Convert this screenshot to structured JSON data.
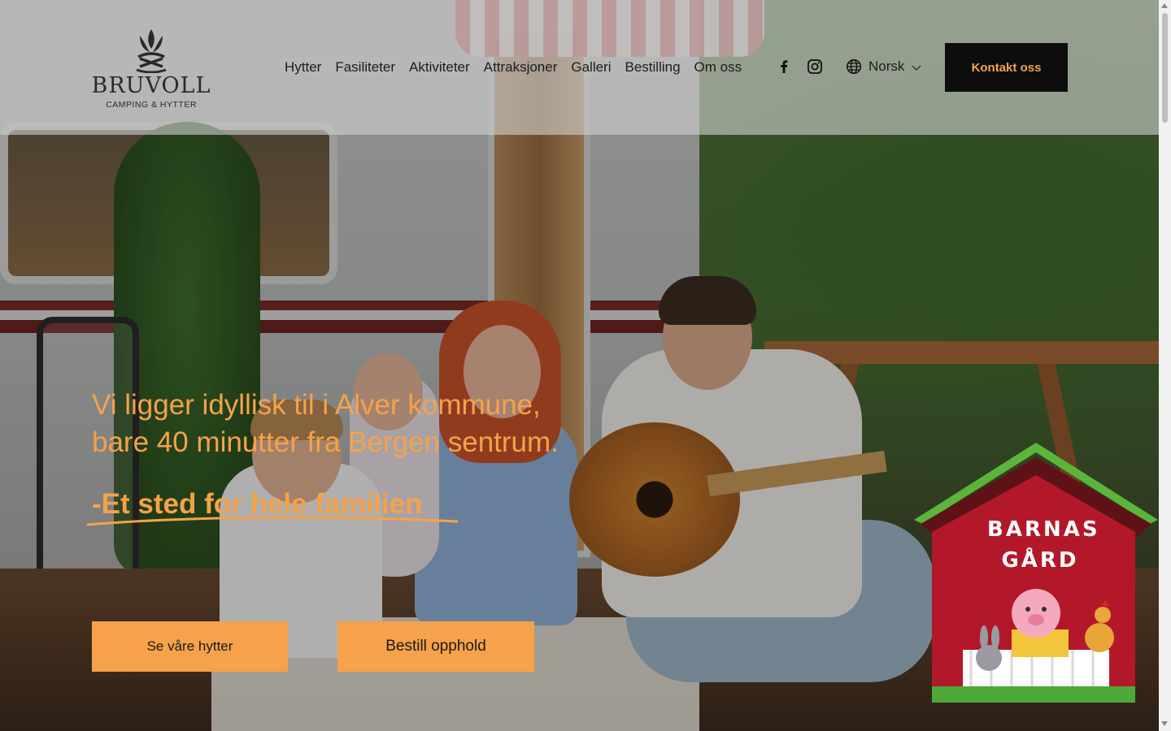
{
  "brand": {
    "name": "BRUVOLL",
    "tagline": "CAMPING & HYTTER",
    "accent_color": "#f5a249",
    "dark_color": "#0d0d0d"
  },
  "nav": {
    "items": [
      "Hytter",
      "Fasiliteter",
      "Aktiviteter",
      "Attraksjoner",
      "Galleri",
      "Bestilling",
      "Om oss"
    ]
  },
  "social": {
    "icons": [
      "facebook-icon",
      "instagram-icon"
    ]
  },
  "language": {
    "icon": "globe-icon",
    "selected": "Norsk"
  },
  "contact_button": "Kontakt oss",
  "hero": {
    "headline_line1": "Vi ligger idyllisk til i Alver kommune,",
    "headline_line2": "bare 40 minutter fra Bergen sentrum.",
    "tagline": "-Et sted for hele familien",
    "buttons": {
      "cabins": "Se våre hytter",
      "book": "Bestill opphold"
    }
  },
  "badge": {
    "line1": "BARNAS",
    "line2": "GÅRD"
  }
}
